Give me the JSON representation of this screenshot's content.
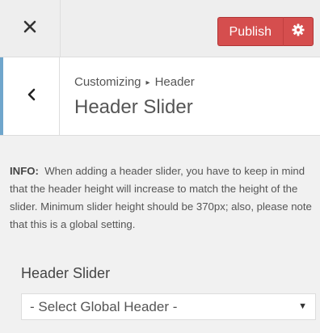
{
  "topbar": {
    "close_icon": "close-icon",
    "publish_label": "Publish",
    "settings_icon": "gear-icon",
    "accent_color": "#d54e4e"
  },
  "section": {
    "back_icon": "chevron-left-icon",
    "breadcrumb_root": "Customizing",
    "breadcrumb_current": "Header",
    "title": "Header Slider"
  },
  "info": {
    "label": "INFO:",
    "text": "When adding a header slider, you have to keep in mind that the header height will increase to match the height of the slider. Minimum slider height should be 370px; also, please note that this is a global setting."
  },
  "control": {
    "label": "Header Slider",
    "selected_value": "- Select Global Header -"
  }
}
